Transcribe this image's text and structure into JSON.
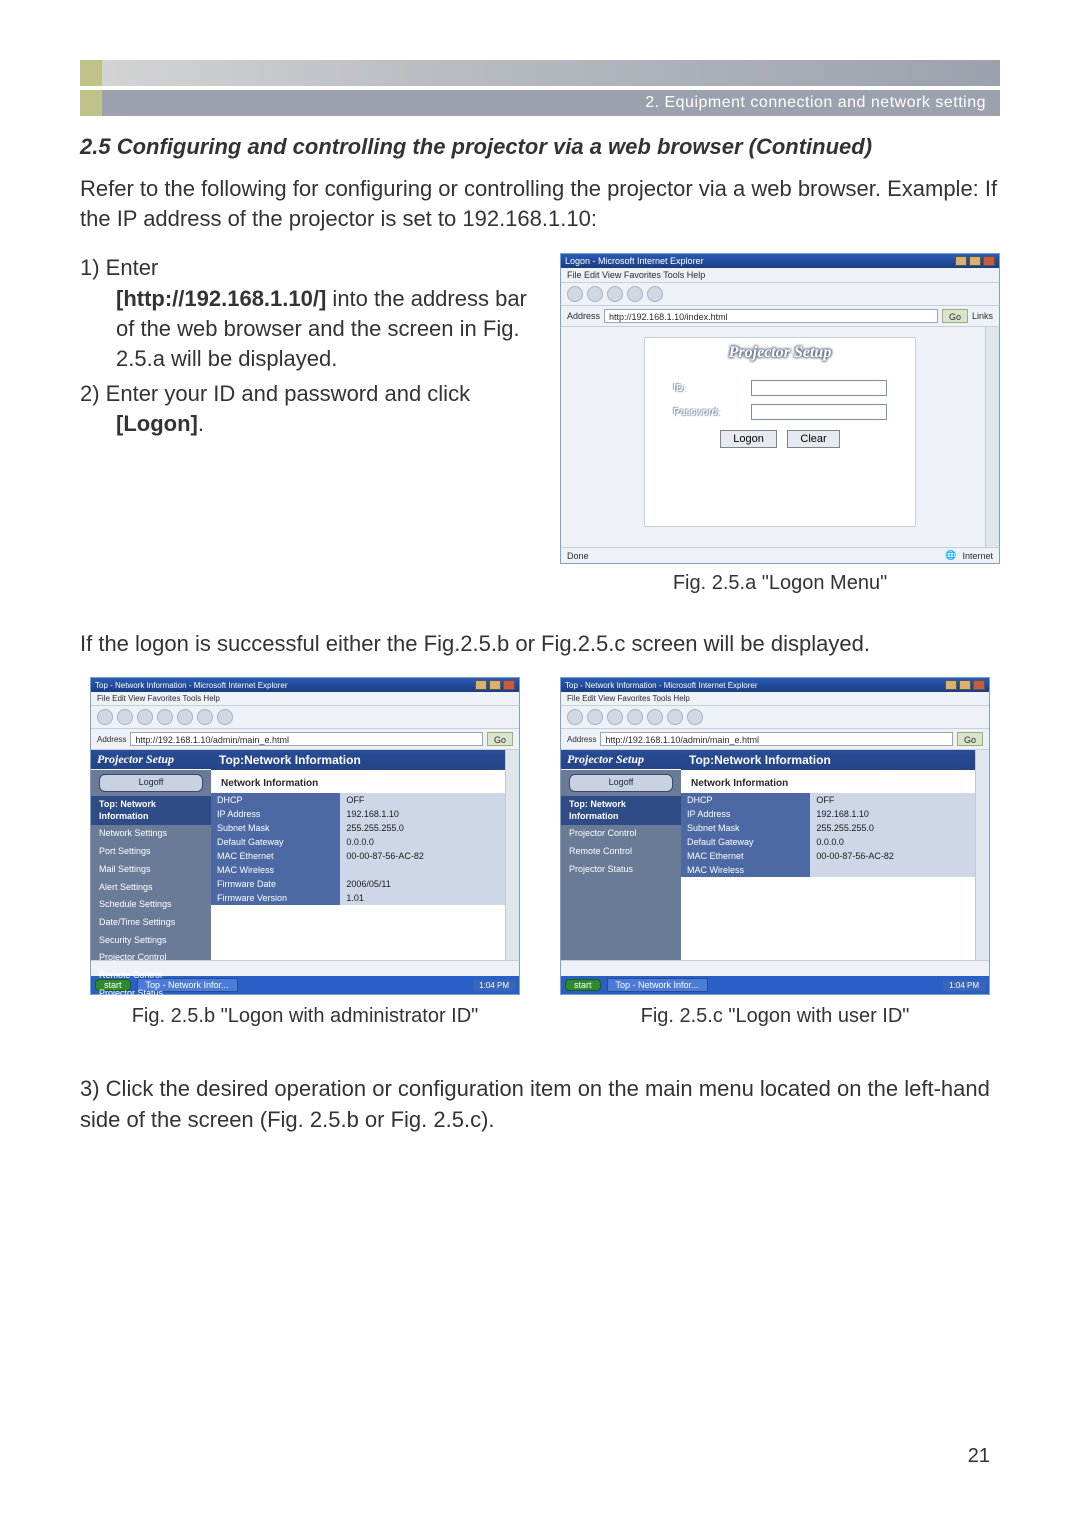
{
  "banner": "2. Equipment connection and network setting",
  "subhead": "2.5 Configuring and controlling the projector via a web browser (Continued)",
  "intro": "Refer to the following for configuring or controlling the projector via a web browser. Example: If the IP address of the projector is set to 192.168.1.10:",
  "step1_prefix": "1) Enter",
  "step1_body_a": "[http://192.168.1.10/]",
  "step1_body_b": " into the address bar of the web browser and the screen in Fig. 2.5.a will be displayed.",
  "step2_prefix": "2) Enter your ID and password and click ",
  "step2_bold": "[Logon]",
  "step2_suffix": ".",
  "mid_para": "If the logon is successful either the Fig.2.5.b or Fig.2.5.c screen will be displayed.",
  "step3_prefix": "3) Click the desired operation or configuration item on the main menu located on the left-hand side of the screen (Fig. 2.5.b or Fig. 2.5.c).",
  "fig_a": {
    "title": "Logon - Microsoft Internet Explorer",
    "menu": "File  Edit  View  Favorites  Tools  Help",
    "address_label": "Address",
    "address": "http://192.168.1.10/index.html",
    "go": "Go",
    "links": "Links",
    "setup_title": "Projector Setup",
    "id_label": "ID:",
    "pw_label": "Password:",
    "logon_btn": "Logon",
    "clear_btn": "Clear",
    "status_left": "Done",
    "status_right": "Internet",
    "caption": "Fig. 2.5.a \"Logon Menu\""
  },
  "common_content": {
    "title": "Top - Network Information - Microsoft Internet Explorer",
    "menu": "File  Edit  View  Favorites  Tools  Help",
    "address_label": "Address",
    "address": "http://192.168.1.10/admin/main_e.html",
    "go": "Go",
    "brand": "Projector Setup",
    "hdr": "Top:Network Information",
    "sub": "Network Information",
    "rows": [
      {
        "k": "DHCP",
        "v": "OFF"
      },
      {
        "k": "IP Address",
        "v": "192.168.1.10"
      },
      {
        "k": "Subnet Mask",
        "v": "255.255.255.0"
      },
      {
        "k": "Default Gateway",
        "v": "0.0.0.0"
      },
      {
        "k": "MAC Ethernet",
        "v": "00-00-87-56-AC-82"
      },
      {
        "k": "MAC Wireless",
        "v": ""
      },
      {
        "k": "Firmware Date",
        "v": "2006/05/11"
      },
      {
        "k": "Firmware Version",
        "v": "1.01"
      }
    ],
    "start": "start",
    "task_item": "Top - Network Infor...",
    "task_time": "1:04 PM"
  },
  "fig_b": {
    "sidebar": {
      "logoff": "Logoff",
      "items": [
        "Top: Network Information",
        "Network Settings",
        "Port Settings",
        "Mail Settings",
        "Alert Settings",
        "Schedule Settings",
        "Date/Time Settings",
        "Security Settings",
        "Projector Control",
        "Remote Control",
        "Projector Status"
      ]
    },
    "caption": "Fig. 2.5.b \"Logon with administrator ID\""
  },
  "fig_c": {
    "sidebar": {
      "logoff": "Logoff",
      "items": [
        "Top: Network Information",
        "Projector Control",
        "Remote Control",
        "Projector Status"
      ]
    },
    "caption": "Fig. 2.5.c \"Logon with user ID\""
  },
  "page_number": "21"
}
